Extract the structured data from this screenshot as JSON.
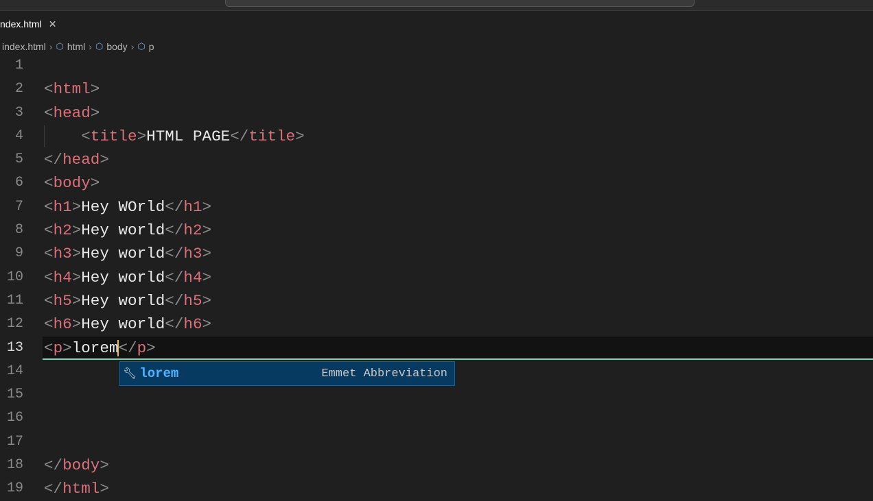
{
  "tab": {
    "title": "ndex.html",
    "close": "✕"
  },
  "breadcrumb": [
    {
      "label": "index.html"
    },
    {
      "label": "html"
    },
    {
      "label": "body"
    },
    {
      "label": "p"
    }
  ],
  "editor": {
    "active_line": 13,
    "lines": [
      [],
      [
        [
          "b",
          "<"
        ],
        [
          "t",
          "html"
        ],
        [
          "b",
          ">"
        ]
      ],
      [
        [
          "b",
          "<"
        ],
        [
          "t",
          "head"
        ],
        [
          "b",
          ">"
        ]
      ],
      [
        [
          "x",
          "    "
        ],
        [
          "b",
          "<"
        ],
        [
          "t",
          "title"
        ],
        [
          "b",
          ">"
        ],
        [
          "x",
          "HTML PAGE"
        ],
        [
          "b",
          "</"
        ],
        [
          "t",
          "title"
        ],
        [
          "b",
          ">"
        ]
      ],
      [
        [
          "b",
          "</"
        ],
        [
          "t",
          "head"
        ],
        [
          "b",
          ">"
        ]
      ],
      [
        [
          "b",
          "<"
        ],
        [
          "t",
          "body"
        ],
        [
          "b",
          ">"
        ]
      ],
      [
        [
          "b",
          "<"
        ],
        [
          "t",
          "h1"
        ],
        [
          "b",
          ">"
        ],
        [
          "x",
          "Hey WOrld"
        ],
        [
          "b",
          "</"
        ],
        [
          "t",
          "h1"
        ],
        [
          "b",
          ">"
        ]
      ],
      [
        [
          "b",
          "<"
        ],
        [
          "t",
          "h2"
        ],
        [
          "b",
          ">"
        ],
        [
          "x",
          "Hey world"
        ],
        [
          "b",
          "</"
        ],
        [
          "t",
          "h2"
        ],
        [
          "b",
          ">"
        ]
      ],
      [
        [
          "b",
          "<"
        ],
        [
          "t",
          "h3"
        ],
        [
          "b",
          ">"
        ],
        [
          "x",
          "Hey world"
        ],
        [
          "b",
          "</"
        ],
        [
          "t",
          "h3"
        ],
        [
          "b",
          ">"
        ]
      ],
      [
        [
          "b",
          "<"
        ],
        [
          "t",
          "h4"
        ],
        [
          "b",
          ">"
        ],
        [
          "x",
          "Hey world"
        ],
        [
          "b",
          "</"
        ],
        [
          "t",
          "h4"
        ],
        [
          "b",
          ">"
        ]
      ],
      [
        [
          "b",
          "<"
        ],
        [
          "t",
          "h5"
        ],
        [
          "b",
          ">"
        ],
        [
          "x",
          "Hey world"
        ],
        [
          "b",
          "</"
        ],
        [
          "t",
          "h5"
        ],
        [
          "b",
          ">"
        ]
      ],
      [
        [
          "b",
          "<"
        ],
        [
          "t",
          "h6"
        ],
        [
          "b",
          ">"
        ],
        [
          "x",
          "Hey world"
        ],
        [
          "b",
          "</"
        ],
        [
          "t",
          "h6"
        ],
        [
          "b",
          ">"
        ]
      ],
      [
        [
          "b",
          "<"
        ],
        [
          "t",
          "p"
        ],
        [
          "b",
          ">"
        ],
        [
          "x",
          "lorem"
        ],
        [
          "cursor",
          ""
        ],
        [
          "b",
          "</"
        ],
        [
          "t",
          "p"
        ],
        [
          "b",
          ">"
        ]
      ],
      [],
      [],
      [],
      [],
      [
        [
          "b",
          "</"
        ],
        [
          "t",
          "body"
        ],
        [
          "b",
          ">"
        ]
      ],
      [
        [
          "b",
          "</"
        ],
        [
          "t",
          "html"
        ],
        [
          "b",
          ">"
        ]
      ]
    ]
  },
  "suggestion": {
    "label": "lorem",
    "detail": "Emmet Abbreviation",
    "icon": "wrench-icon"
  }
}
